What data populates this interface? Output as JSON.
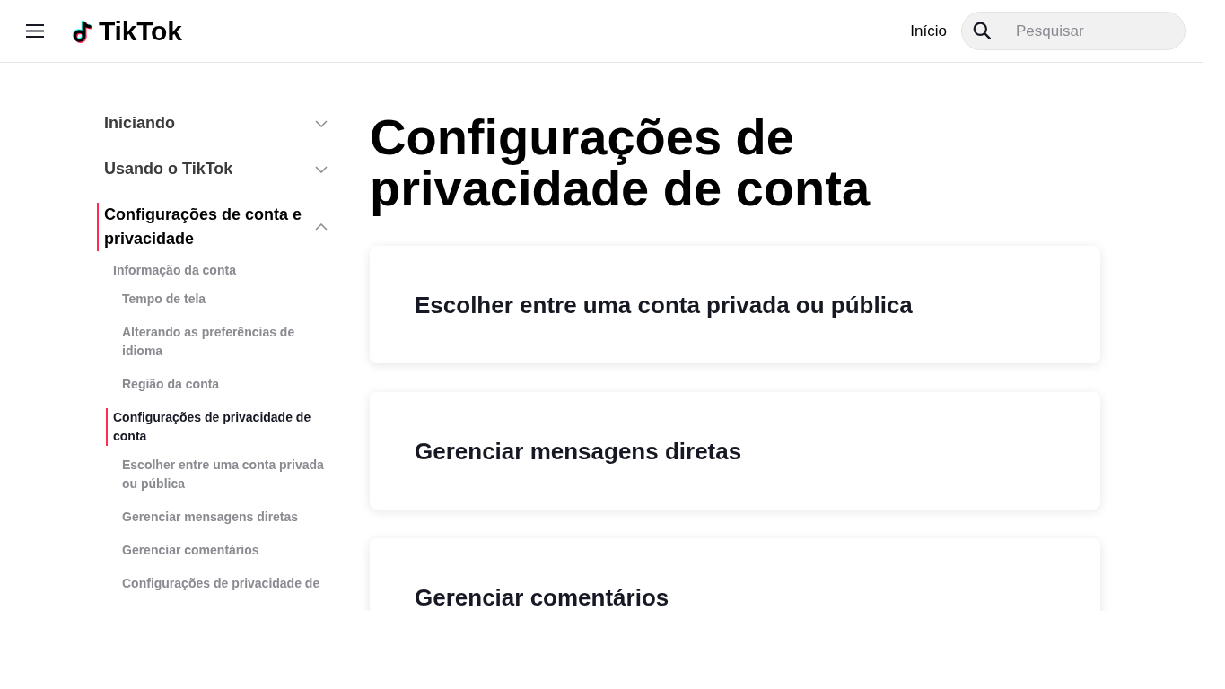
{
  "header": {
    "logo": "TikTok",
    "nav_link": "Início",
    "search": {
      "placeholder": "Pesquisar"
    }
  },
  "sidebar": {
    "items": [
      {
        "label": "Iniciando",
        "selected": false,
        "expanded": false
      },
      {
        "label": "Usando o TikTok",
        "selected": false,
        "expanded": false
      },
      {
        "label": "Configurações de conta e privacidade",
        "selected": true,
        "expanded": true,
        "children": [
          {
            "label": "Informação da conta",
            "selected": false,
            "children": [
              {
                "label": "Tempo de tela",
                "selected": false
              },
              {
                "label": "Alterando as preferências de idioma",
                "selected": false
              },
              {
                "label": "Região da conta",
                "selected": false
              }
            ]
          },
          {
            "label": "Configurações de privacidade de conta",
            "selected": true,
            "children": [
              {
                "label": "Escolher entre uma conta privada ou pública",
                "selected": false
              },
              {
                "label": "Gerenciar mensagens diretas",
                "selected": false
              },
              {
                "label": "Gerenciar comentários",
                "selected": false
              },
              {
                "label": "Configurações de privacidade de",
                "selected": false
              }
            ]
          }
        ]
      }
    ]
  },
  "page": {
    "title": "Configurações de privacidade de conta",
    "articles": [
      {
        "title": "Escolher entre uma conta privada ou pública"
      },
      {
        "title": "Gerenciar mensagens diretas"
      },
      {
        "title": "Gerenciar comentários"
      }
    ]
  }
}
